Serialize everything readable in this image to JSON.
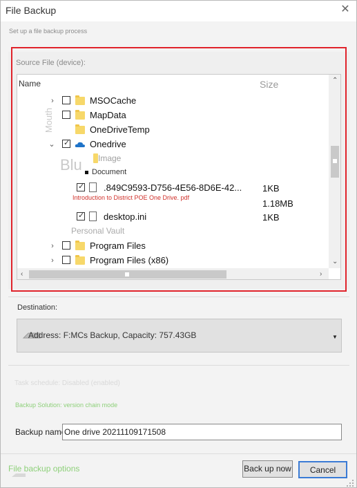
{
  "window": {
    "title": "File Backup",
    "close_icon": "close-icon"
  },
  "subtitle": "Set up a file backup process",
  "source": {
    "label": "Source File (device):",
    "columns": {
      "name": "Name",
      "size": "Size"
    },
    "ghost_text": {
      "mouth": "Mouth",
      "blue": "Blu"
    },
    "rows": [
      {
        "label": "MSOCache",
        "size": ""
      },
      {
        "label": "MapData",
        "size": ""
      },
      {
        "label": "OneDriveTemp",
        "size": ""
      },
      {
        "label": "Onedrive",
        "size": ""
      },
      {
        "label": "Image",
        "size": ""
      },
      {
        "label": "Document",
        "size": ""
      },
      {
        "label": ".849C9593-D756-4E56-8D6E-42...",
        "size": "1KB"
      },
      {
        "label": "Introduction to District POE One Drive. pdf",
        "size": "1.18MB"
      },
      {
        "label": "desktop.ini",
        "size": "1KB"
      },
      {
        "label": "Personal Vault",
        "size": ""
      },
      {
        "label": "Program Files",
        "size": ""
      },
      {
        "label": "Program Files (x86)",
        "size": ""
      }
    ]
  },
  "destination": {
    "label": "Destination:",
    "value": "Address: F:MCs Backup, Capacity: 757.43GB"
  },
  "schedule": {
    "text": "Task schedule: Disabled (enabled)"
  },
  "solution": {
    "text": "Backup Solution: version chain mode"
  },
  "backup_name": {
    "label": "Backup name:",
    "value": "One drive 20211109171508"
  },
  "footer": {
    "options_link": "File backup options",
    "back_up_now": "Back up now",
    "cancel": "Cancel"
  },
  "colors": {
    "highlight_frame": "#e0222a",
    "accent_link": "#8ed07a",
    "default_button_border": "#3a7bd5"
  }
}
